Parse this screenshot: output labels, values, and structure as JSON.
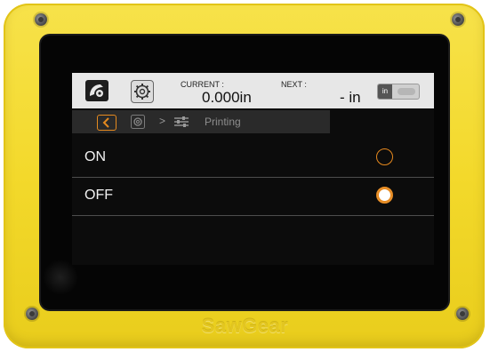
{
  "device": {
    "brand": "SawGear",
    "colors": {
      "housing": "#f3d92b",
      "bezel": "#050505",
      "accent": "#e6891e"
    }
  },
  "topbar": {
    "logo_icon": "saw-logo-icon",
    "settings_icon": "gear-icon",
    "current_label": "CURRENT :",
    "current_value": "0.000in",
    "next_label": "NEXT :",
    "next_value": "- in",
    "unit_toggle_label": "in"
  },
  "breadcrumb": {
    "back_icon": "chevron-left-icon",
    "settings_icon": "gear-icon",
    "separator": ">",
    "section_icon": "sliders-icon",
    "current_page": "Printing"
  },
  "options": [
    {
      "label": "ON",
      "selected": false
    },
    {
      "label": "OFF",
      "selected": true
    }
  ]
}
